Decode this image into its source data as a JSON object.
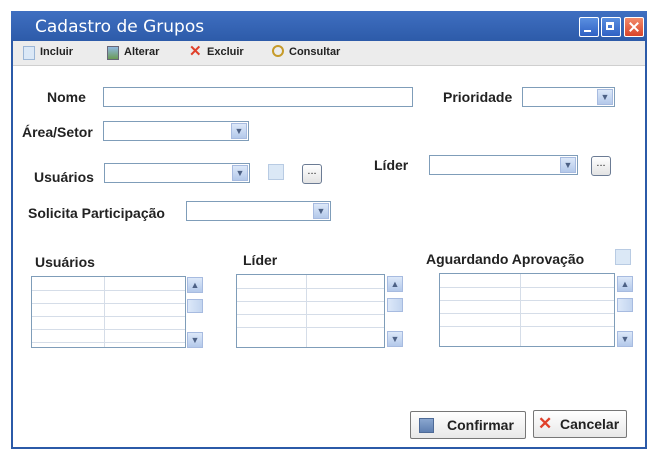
{
  "window": {
    "title": "Cadastro de Grupos"
  },
  "toolbar": {
    "incluir": "Incluir",
    "alterar": "Alterar",
    "excluir": "Excluir",
    "consultar": "Consultar"
  },
  "form": {
    "nome_label": "Nome",
    "nome_value": "",
    "prioridade_label": "Prioridade",
    "prioridade_value": "",
    "area_label": "Área/Setor",
    "area_value": "",
    "usuarios_label": "Usuários",
    "usuarios_value": "",
    "lider_label": "Líder",
    "lider_value": "",
    "ellipsis": "...",
    "solicita_label": "Solicita Participação",
    "solicita_value": ""
  },
  "lists": {
    "usuarios_title": "Usuários",
    "lider_title": "Líder",
    "aguardando_title": "Aguardando Aprovação"
  },
  "buttons": {
    "confirmar": "Confirmar",
    "cancelar": "Cancelar"
  }
}
